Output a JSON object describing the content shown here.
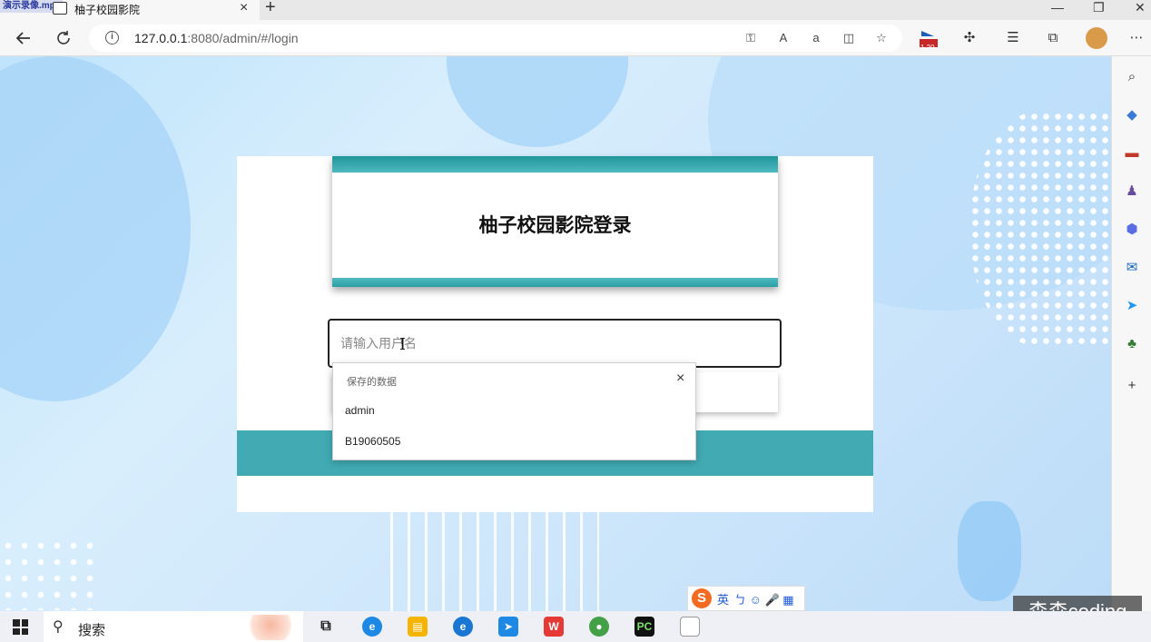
{
  "window": {
    "overlay_label": "演示录像.mp4",
    "tab_title": "柚子校园影院",
    "tab_close": "×",
    "new_tab": "+",
    "minimize": "—",
    "restore": "❐",
    "close": "✕"
  },
  "navbar": {
    "url_host": "127.0.0.1",
    "url_rest": ":8080/admin/#/login",
    "ext_badge": "1.20"
  },
  "login": {
    "heading": "柚子校园影院登录",
    "username_placeholder": "请输入用户名"
  },
  "autocomplete": {
    "header": "保存的数据",
    "close": "×",
    "items": [
      "admin",
      "B19060505"
    ]
  },
  "ime": {
    "lang": "英",
    "glyphs": "ㄅ ☺ 🎤 ▦"
  },
  "watermark": "森森coding",
  "taskbar": {
    "search_label": "搜索"
  },
  "colors": {
    "teal": "#41aab3",
    "accent": "#1f979a"
  }
}
